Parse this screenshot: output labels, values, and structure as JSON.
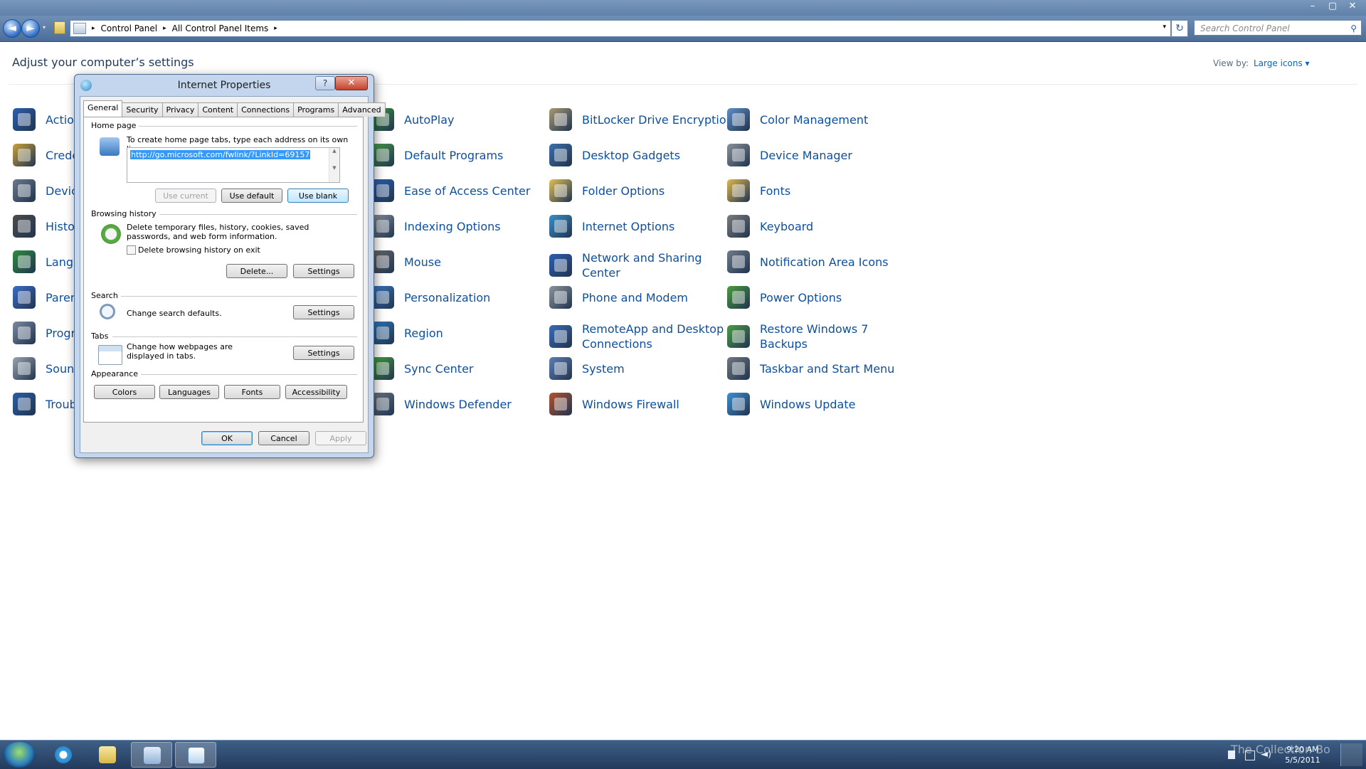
{
  "window": {
    "controls": [
      "–",
      "▢",
      "✕"
    ]
  },
  "navbar": {
    "back_glyph": "◄",
    "forward_glyph": "►",
    "history_glyph": "▾",
    "breadcrumbs": [
      "Control Panel",
      "All Control Panel Items"
    ],
    "breadcrumb_sep": "▸",
    "address_dropdown_glyph": "▾",
    "refresh_glyph": "↻",
    "search_placeholder": "Search Control Panel",
    "search_glyph": "⚲"
  },
  "content": {
    "title": "Adjust your computer’s settings",
    "view_by_label": "View by:",
    "view_by_value": "Large icons ▾",
    "columns": [
      {
        "items": [
          {
            "label": "Action",
            "icon": "action-center-icon",
            "color": "#2b5fb0"
          },
          {
            "label": "Crede",
            "icon": "credential-manager-icon",
            "color": "#c8a23b"
          },
          {
            "label": "Device",
            "icon": "devices-printers-icon",
            "color": "#6b7a8c"
          },
          {
            "label": "Histor",
            "icon": "history-icon",
            "color": "#4c4c4c"
          },
          {
            "label": "Langu",
            "icon": "language-icon",
            "color": "#2f8c3f"
          },
          {
            "label": "Parent",
            "icon": "parental-controls-icon",
            "color": "#3c6ec8"
          },
          {
            "label": "Progra",
            "icon": "programs-icon",
            "color": "#7a8aa0"
          },
          {
            "label": "Sound",
            "icon": "sound-icon",
            "color": "#9aa4ae"
          },
          {
            "label": "Troub",
            "icon": "troubleshooting-icon",
            "color": "#2a5fa6"
          }
        ]
      },
      {
        "items": [
          {
            "label": "AutoPlay",
            "icon": "autoplay-icon",
            "color": "#3f9a3a"
          },
          {
            "label": "Default Programs",
            "icon": "default-programs-icon",
            "color": "#4aa04a"
          },
          {
            "label": "Ease of Access Center",
            "icon": "ease-of-access-icon",
            "color": "#2d63b5"
          },
          {
            "label": "Indexing Options",
            "icon": "indexing-options-icon",
            "color": "#8a949f"
          },
          {
            "label": "Mouse",
            "icon": "mouse-icon",
            "color": "#6c6c6c"
          },
          {
            "label": "Personalization",
            "icon": "personalization-icon",
            "color": "#3a7cc4"
          },
          {
            "label": "Region",
            "icon": "region-icon",
            "color": "#2f7bbf"
          },
          {
            "label": "Sync Center",
            "icon": "sync-center-icon",
            "color": "#46a43a"
          },
          {
            "label": "Windows Defender",
            "icon": "windows-defender-icon",
            "color": "#6e7a86"
          }
        ]
      },
      {
        "items": [
          {
            "label": "BitLocker Drive Encryption",
            "icon": "bitlocker-icon",
            "color": "#a89a74"
          },
          {
            "label": "Desktop Gadgets",
            "icon": "desktop-gadgets-icon",
            "color": "#3d6fa8"
          },
          {
            "label": "Folder Options",
            "icon": "folder-options-icon",
            "color": "#e2c05a"
          },
          {
            "label": "Internet Options",
            "icon": "internet-options-icon",
            "color": "#3a8fc8"
          },
          {
            "label": "Network and Sharing\nCenter",
            "icon": "network-sharing-icon",
            "color": "#2d5fb0"
          },
          {
            "label": "Phone and Modem",
            "icon": "phone-modem-icon",
            "color": "#8c949c"
          },
          {
            "label": "RemoteApp and Desktop\nConnections",
            "icon": "remoteapp-icon",
            "color": "#3a6cb8"
          },
          {
            "label": "System",
            "icon": "system-icon",
            "color": "#5d7fb4"
          },
          {
            "label": "Windows Firewall",
            "icon": "windows-firewall-icon",
            "color": "#b4532d"
          }
        ]
      },
      {
        "items": [
          {
            "label": "Color Management",
            "icon": "color-management-icon",
            "color": "#5f8fc8"
          },
          {
            "label": "Device Manager",
            "icon": "device-manager-icon",
            "color": "#8a929a"
          },
          {
            "label": "Fonts",
            "icon": "fonts-icon",
            "color": "#e0b84e"
          },
          {
            "label": "Keyboard",
            "icon": "keyboard-icon",
            "color": "#7c7c7c"
          },
          {
            "label": "Notification Area Icons",
            "icon": "notification-area-icon",
            "color": "#6f7c8a"
          },
          {
            "label": "Power Options",
            "icon": "power-options-icon",
            "color": "#4a9c3e"
          },
          {
            "label": "Restore Windows 7\nBackups",
            "icon": "restore-backups-icon",
            "color": "#4c9e45"
          },
          {
            "label": "Taskbar and Start Menu",
            "icon": "taskbar-start-menu-icon",
            "color": "#707880"
          },
          {
            "label": "Windows Update",
            "icon": "windows-update-icon",
            "color": "#3f8fd0"
          }
        ]
      }
    ]
  },
  "dialog": {
    "title": "Internet Properties",
    "help_glyph": "?",
    "close_glyph": "✕",
    "tabs": [
      "General",
      "Security",
      "Privacy",
      "Content",
      "Connections",
      "Programs",
      "Advanced"
    ],
    "home_page": {
      "group_title": "Home page",
      "instruction": "To create home page tabs, type each address on its own line.",
      "url": "http://go.microsoft.com/fwlink/?LinkId=69157",
      "use_current": "Use current",
      "use_default": "Use default",
      "use_blank": "Use blank"
    },
    "browsing_history": {
      "group_title": "Browsing history",
      "description": "Delete temporary files, history, cookies, saved passwords, and web form information.",
      "delete_on_exit": "Delete browsing history on exit",
      "delete_button": "Delete...",
      "settings_button": "Settings"
    },
    "search": {
      "group_title": "Search",
      "description": "Change search defaults.",
      "settings_button": "Settings"
    },
    "tabs_group": {
      "group_title": "Tabs",
      "description": "Change how webpages are displayed in tabs.",
      "settings_button": "Settings"
    },
    "appearance": {
      "group_title": "Appearance",
      "colors": "Colors",
      "languages": "Languages",
      "fonts": "Fonts",
      "accessibility": "Accessibility"
    },
    "footer": {
      "ok": "OK",
      "cancel": "Cancel",
      "apply": "Apply"
    }
  },
  "taskbar": {
    "time": "9:20 AM",
    "date": "5/5/2011",
    "watermark": "The Collection Bo"
  }
}
